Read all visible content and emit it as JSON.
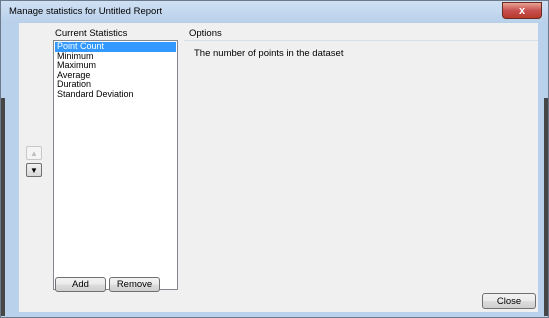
{
  "window": {
    "title": "Manage statistics for Untitled Report",
    "close_glyph": "x"
  },
  "statistics": {
    "label": "Current Statistics",
    "items": [
      "Point Count",
      "Minimum",
      "Maximum",
      "Average",
      "Duration",
      "Standard Deviation"
    ],
    "selected_index": 0
  },
  "reorder": {
    "up_icon": "triangle-up-icon",
    "down_icon": "triangle-down-icon",
    "up_glyph": "▲",
    "down_glyph": "▼"
  },
  "buttons": {
    "add_label": "Add",
    "remove_label": "Remove",
    "close_label": "Close"
  },
  "options": {
    "label": "Options",
    "description": "The number of points in the dataset"
  },
  "colors": {
    "selection": "#3399ff",
    "frame": "#b9d1ea",
    "client": "#f0f0f0"
  }
}
